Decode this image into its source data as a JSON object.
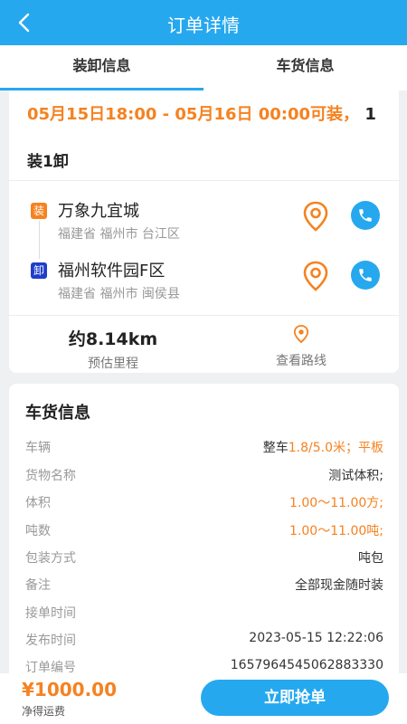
{
  "header": {
    "title": "订单详情"
  },
  "tabs": [
    {
      "label": "装卸信息"
    },
    {
      "label": "车货信息"
    }
  ],
  "schedule": {
    "time_text": "05月15日18:00 - 05月16日 00:00可装，",
    "count": "1"
  },
  "load_unload_label": "装1卸",
  "locations": [
    {
      "badge": "装",
      "badge_color": "#f58220",
      "name": "万象九宜城",
      "address": "福建省 福州市 台江区"
    },
    {
      "badge": "卸",
      "badge_color": "#1f3fc9",
      "name": "福州软件园F区",
      "address": "福建省 福州市 闽侯县"
    }
  ],
  "distance": {
    "value": "约8.14km",
    "label": "预估里程"
  },
  "route": {
    "label": "查看路线"
  },
  "cargo": {
    "title": "车货信息",
    "rows": [
      {
        "key": "车辆",
        "prefix": "整车",
        "value": "1.8/5.0米；平板"
      },
      {
        "key": "货物名称",
        "value": "测试体积;"
      },
      {
        "key": "体积",
        "value": "1.00～11.00方;"
      },
      {
        "key": "吨数",
        "value": "1.00～11.00吨;"
      },
      {
        "key": "包装方式",
        "value": "吨包"
      },
      {
        "key": "备注",
        "value": "全部现金随时装"
      },
      {
        "key": "接单时间",
        "value": ""
      },
      {
        "key": "发布时间",
        "value": "2023-05-15 12:22:06"
      },
      {
        "key": "订单编号",
        "value": "1657964545062883330"
      }
    ]
  },
  "footer": {
    "price": "¥1000.00",
    "price_label": "净得运费",
    "grab_label": "立即抢单"
  },
  "colors": {
    "primary": "#26a8ef",
    "accent": "#f58220"
  }
}
